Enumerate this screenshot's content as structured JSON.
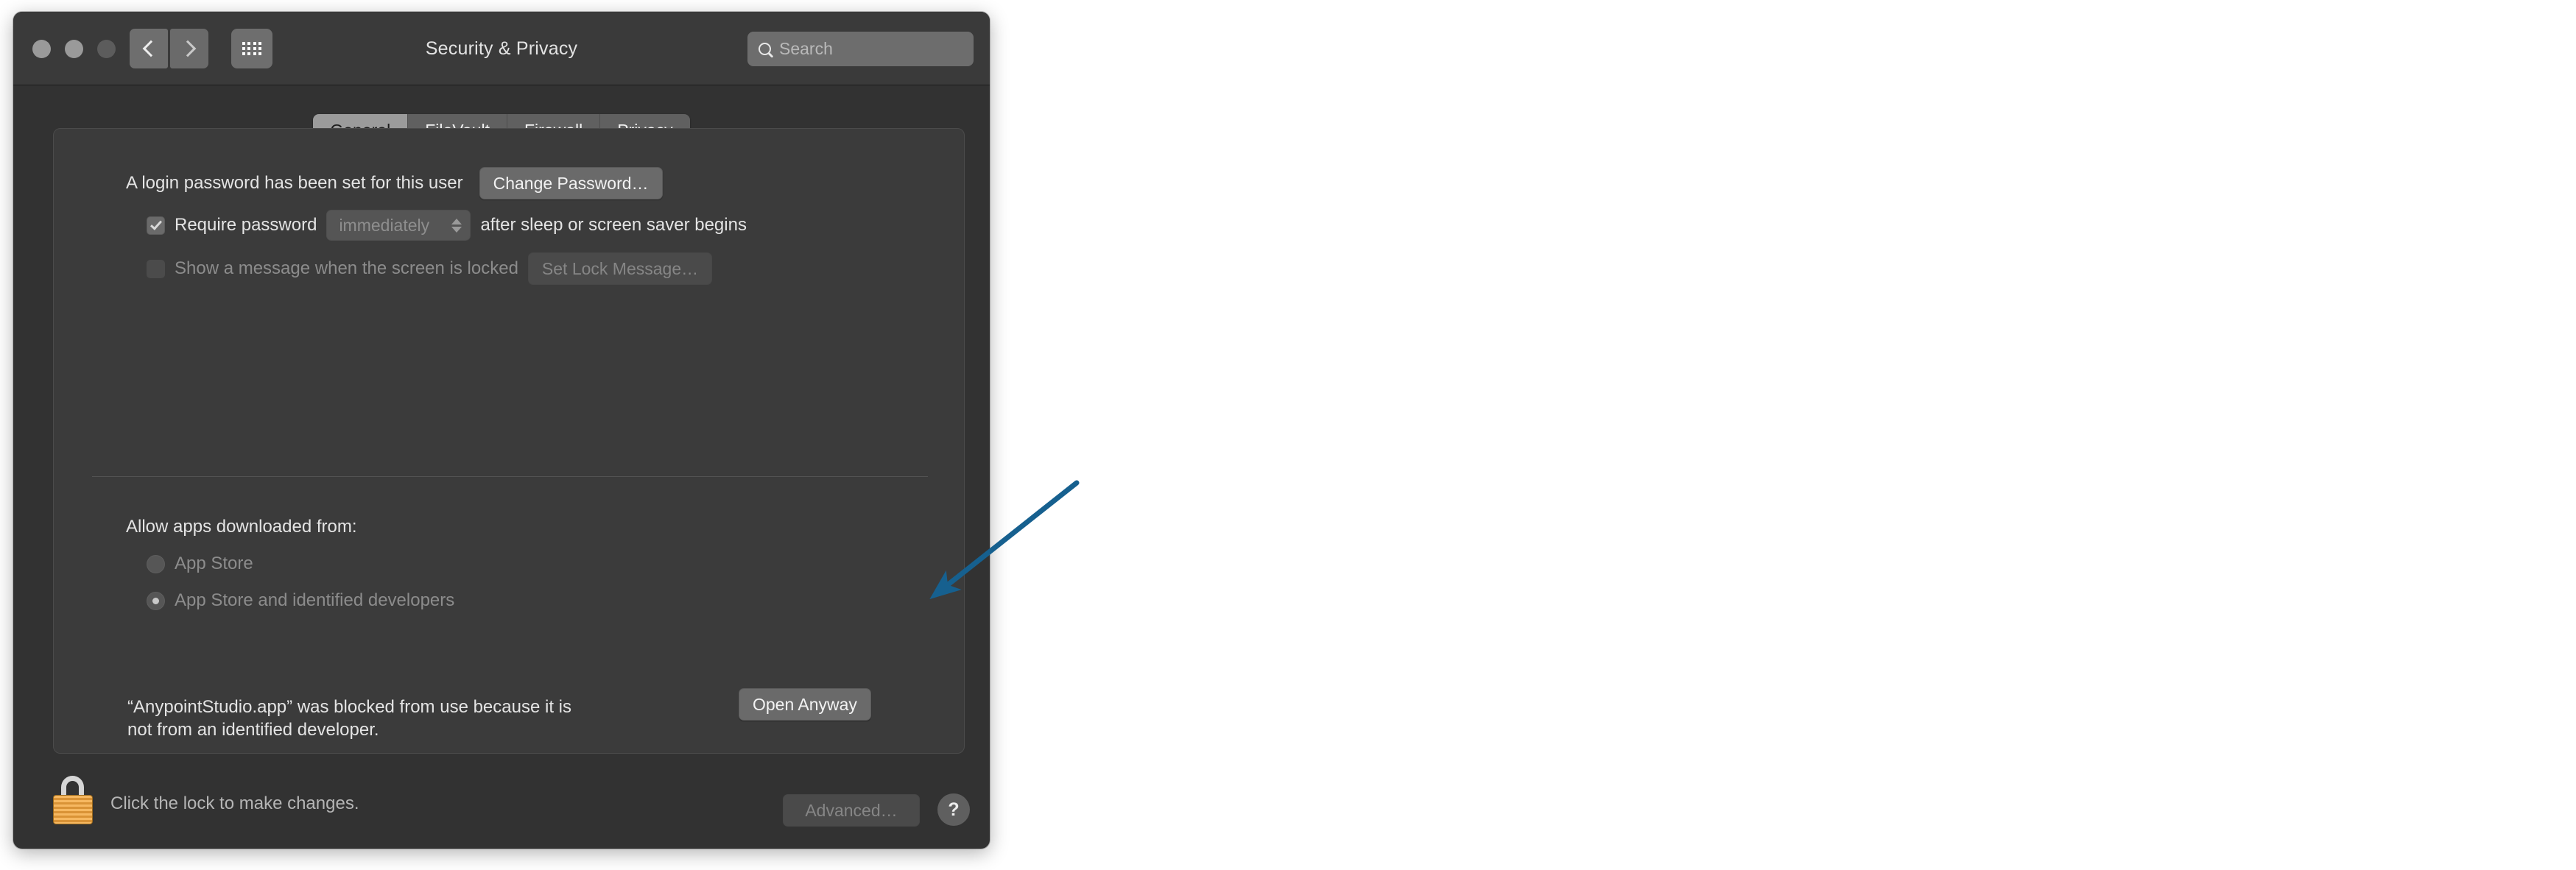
{
  "window": {
    "title": "Security & Privacy",
    "traffic_lights": [
      "close-button",
      "minimize-button",
      "zoom-button"
    ],
    "toolbar": {
      "back_icon": "chevron-left-icon",
      "forward_icon": "chevron-right-icon",
      "grid_icon": "show-all-preferences-icon",
      "search_placeholder": "Search",
      "search_value": "",
      "search_icon": "search-icon"
    }
  },
  "tabs": [
    {
      "label": "General",
      "active": true
    },
    {
      "label": "FileVault",
      "active": false
    },
    {
      "label": "Firewall",
      "active": false
    },
    {
      "label": "Privacy",
      "active": false
    }
  ],
  "general": {
    "login_password_text": "A login password has been set for this user",
    "change_password_button": "Change Password…",
    "require_password": {
      "label": "Require password",
      "checked": true,
      "interval_value": "immediately",
      "suffix": "after sleep or screen saver begins"
    },
    "lock_message": {
      "label": "Show a message when the screen is locked",
      "checked": false,
      "button": "Set Lock Message…"
    },
    "allow_apps_heading": "Allow apps downloaded from:",
    "allow_apps_options": [
      {
        "label": "App Store",
        "selected": false
      },
      {
        "label": "App Store and identified developers",
        "selected": true
      }
    ],
    "blocked_message": "“AnypointStudio.app” was blocked from use because it is not from an identified developer.",
    "open_anyway_button": "Open Anyway"
  },
  "bottom_bar": {
    "lock_icon": "padlock-unlocked-icon",
    "lock_text": "Click the lock to make changes.",
    "advanced_button": "Advanced…",
    "help_button": "?"
  },
  "annotation": {
    "arrow_color": "#16608f",
    "points_to": "open-anyway-button"
  }
}
